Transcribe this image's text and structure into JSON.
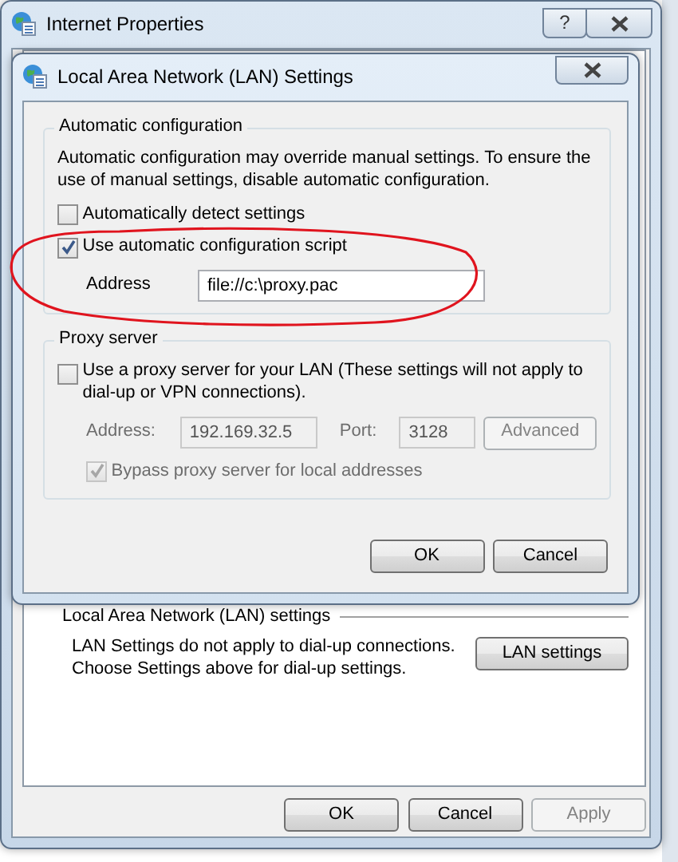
{
  "window": {
    "title": "Internet Properties",
    "help_button": "?"
  },
  "lan_section": {
    "legend": "Local Area Network (LAN) settings",
    "note": [
      "LAN Settings do not apply to dial-up connections.",
      "Choose Settings above for dial-up settings."
    ],
    "button": "LAN settings"
  },
  "buttons": [
    {
      "label": "OK",
      "disabled": false
    },
    {
      "label": "Cancel",
      "disabled": false
    },
    {
      "label": "Apply",
      "disabled": true
    }
  ],
  "dialog": {
    "title": "Local Area Network (LAN) Settings",
    "automatic": {
      "legend": "Automatic configuration",
      "description": "Automatic configuration may override manual settings.  To ensure the use of manual settings, disable automatic configuration.",
      "options": [
        {
          "label": "Automatically detect settings",
          "checked": false
        },
        {
          "label": "Use automatic configuration script",
          "checked": true
        }
      ],
      "address": {
        "label": "Address",
        "value": "file://c:\\proxy.pac"
      }
    },
    "proxy": {
      "legend": "Proxy server",
      "option": {
        "label": "Use a proxy server for your LAN (These settings will not apply to dial-up or VPN connections).",
        "checked": false
      },
      "address": {
        "label": "Address:",
        "value": "192.169.32.5",
        "disabled": true
      },
      "port": {
        "label": "Port:",
        "value": "3128",
        "disabled": true
      },
      "advanced": {
        "label": "Advanced",
        "disabled": true
      },
      "bypass": {
        "label": "Bypass proxy server for local addresses",
        "checked": true,
        "disabled": true
      }
    },
    "buttons": [
      {
        "label": "OK",
        "disabled": false
      },
      {
        "label": "Cancel",
        "disabled": false
      }
    ]
  }
}
